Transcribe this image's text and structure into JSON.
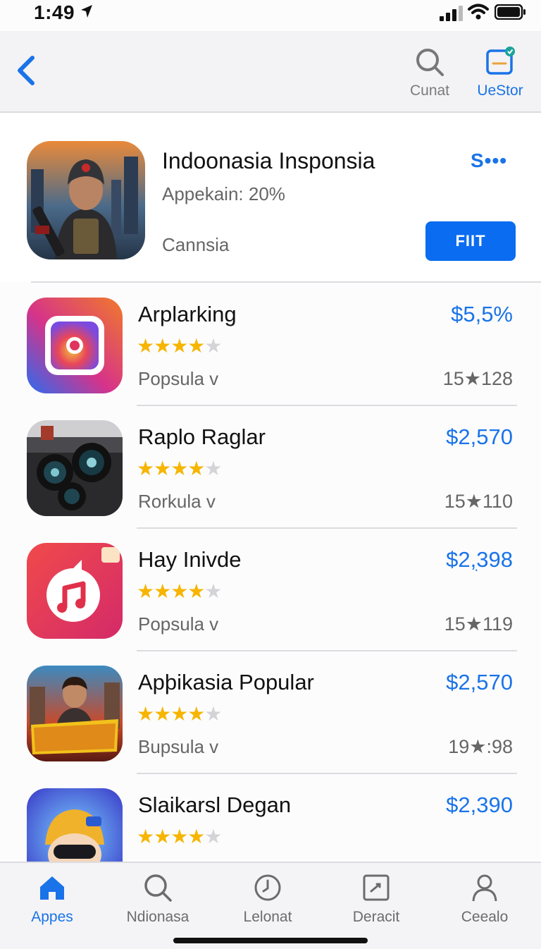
{
  "status_bar": {
    "time": "1:49"
  },
  "nav": {
    "actions": [
      {
        "label": "Cunat",
        "icon": "search-icon"
      },
      {
        "label": "UeStor",
        "icon": "store-badge-icon"
      }
    ]
  },
  "featured": {
    "title": "Indoonasia Insponsia",
    "subtitle": "Appekain: 20%",
    "category": "Cannsia",
    "more": "S•••",
    "button": "FIIT"
  },
  "apps": [
    {
      "name": "Arplarking",
      "rating": 4,
      "category": "Popsula v",
      "price": "$5,5%",
      "count": "15★128",
      "icon": "camera-square-icon"
    },
    {
      "name": "Raplo Raglar",
      "rating": 4,
      "category": "Rorkula v",
      "price": "$2,570",
      "count": "15★110",
      "icon": "retro-camera-icon"
    },
    {
      "name": "Hay Inivde",
      "rating": 4,
      "category": "Popsula v",
      "price": "$2,ׅ398",
      "count": "15★119",
      "icon": "music-note-icon"
    },
    {
      "name": "Apϸikasia Popular",
      "rating": 4,
      "category": "Bupsula v",
      "price": "$2,570",
      "count": "19★:98",
      "icon": "game-poster-icon"
    },
    {
      "name": "Slaikarsl Degan",
      "rating": 4,
      "category": "",
      "price": "$2,390",
      "count": "",
      "icon": "cartoon-character-icon"
    }
  ],
  "tabs": [
    {
      "label": "Appes",
      "icon": "home-icon",
      "active": true
    },
    {
      "label": "Ndionasa",
      "icon": "search-icon",
      "active": false
    },
    {
      "label": "Lelonat",
      "icon": "clock-icon",
      "active": false
    },
    {
      "label": "Deracit",
      "icon": "square-pen-icon",
      "active": false
    },
    {
      "label": "Ceealo",
      "icon": "person-icon",
      "active": false
    }
  ],
  "colors": {
    "accent": "#1a73e8",
    "button": "#0a6cf0",
    "star": "#f6b500"
  }
}
